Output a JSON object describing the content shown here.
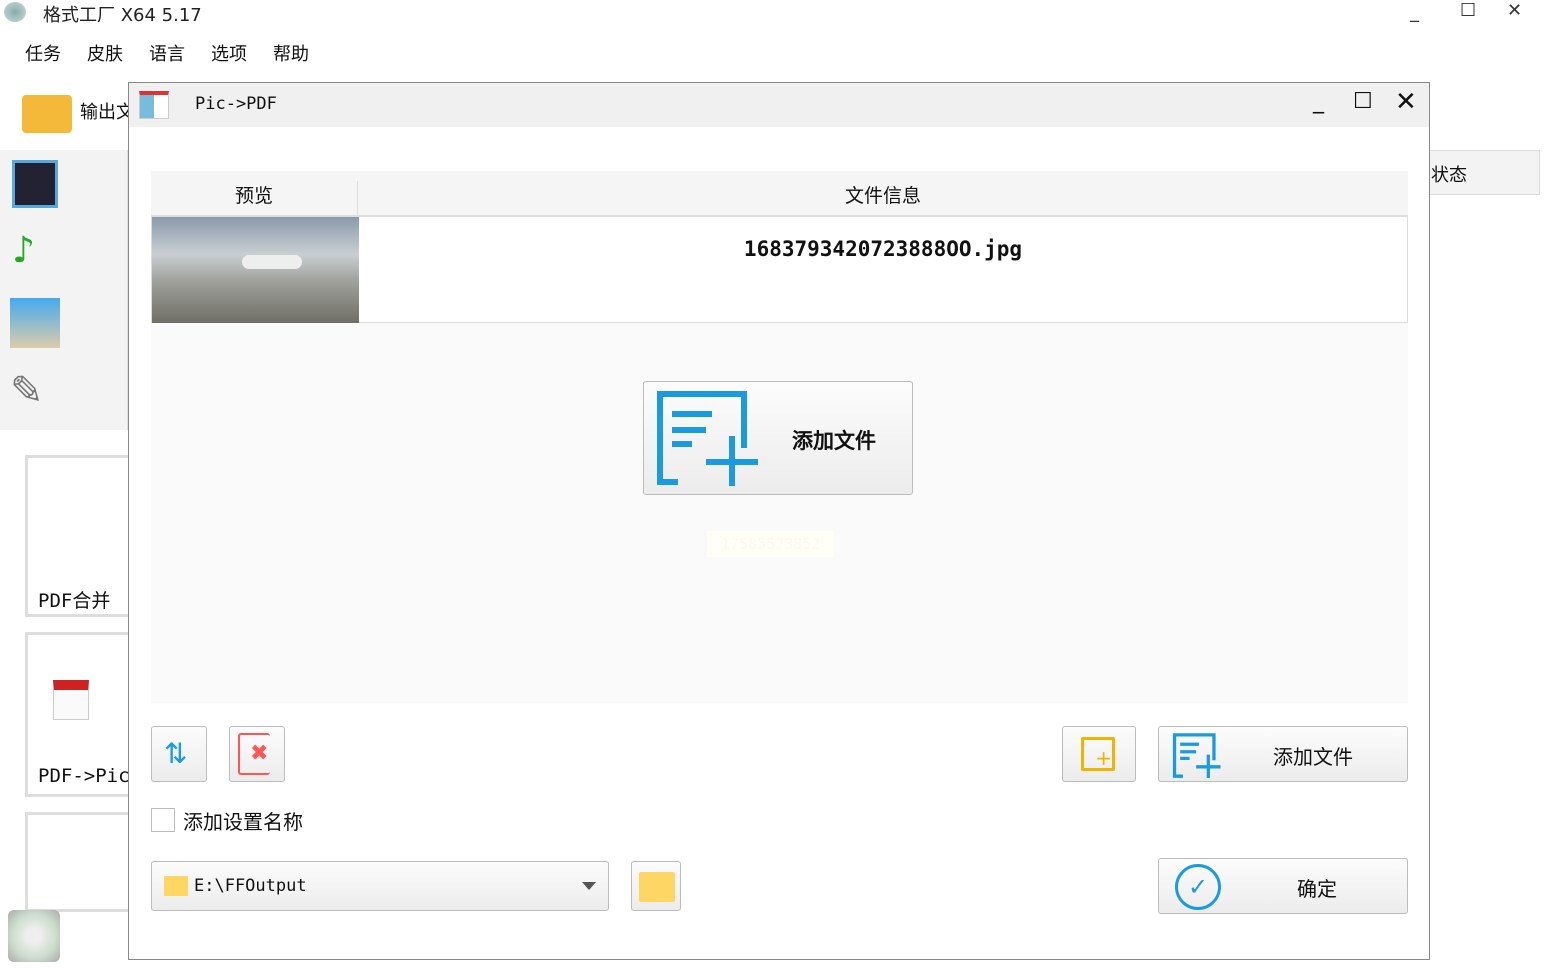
{
  "app": {
    "title": "格式工厂 X64 5.17",
    "menu": [
      "任务",
      "皮肤",
      "语言",
      "选项",
      "帮助"
    ],
    "output_label": "输出文件夹",
    "status_header": "状态",
    "side_cards": [
      "PDF合并",
      "PDF->Pic"
    ]
  },
  "dialog": {
    "title": "Pic->PDF",
    "columns": [
      "预览",
      "文件信息"
    ],
    "files": [
      {
        "name": "1683793420723888OO.jpg"
      }
    ],
    "add_file_big": "添加文件",
    "watermark": "17585523852",
    "add_file": "添加文件",
    "add_setting_name": "添加设置名称",
    "output_path": "E:\\FFOutput",
    "ok": "确定"
  },
  "colors": {
    "accent": "#1a9be0",
    "folder": "#fdd663"
  }
}
